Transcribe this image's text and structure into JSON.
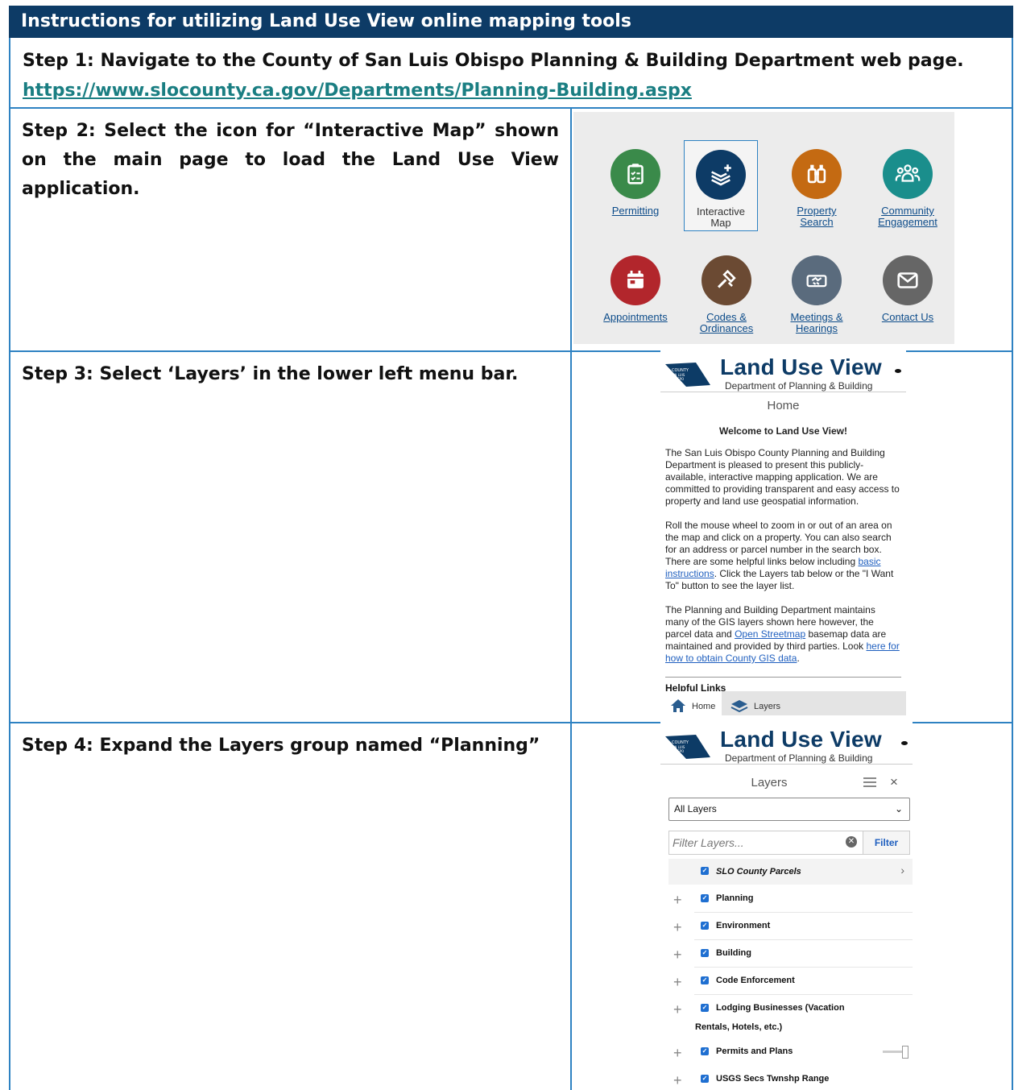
{
  "header": {
    "title": "Instructions for utilizing Land Use View online mapping tools"
  },
  "step1": {
    "text": "Step 1: Navigate to the County of San Luis Obispo Planning & Building Department web page.",
    "link": "https://www.slocounty.ca.gov/Departments/Planning-Building.aspx"
  },
  "step2": {
    "text": "Step 2: Select the icon for “Interactive Map” shown on the main page to load the Land Use View application.",
    "icons": [
      {
        "line1": "Permitting",
        "line2": "",
        "color": "#3a8a4a",
        "icon": "clipboard-icon"
      },
      {
        "line1": "Interactive",
        "line2": "Map",
        "color": "#0d3b66",
        "icon": "layers-plus-icon"
      },
      {
        "line1": "Property",
        "line2": "Search",
        "color": "#c46a12",
        "icon": "binoculars-icon"
      },
      {
        "line1": "Community",
        "line2": "Engagement",
        "color": "#1a8e8c",
        "icon": "people-icon"
      },
      {
        "line1": "Appointments",
        "line2": "",
        "color": "#b2262c",
        "icon": "calendar-icon"
      },
      {
        "line1": "Codes &",
        "line2": "Ordinances",
        "color": "#6b4a33",
        "icon": "gavel-icon"
      },
      {
        "line1": "Meetings &",
        "line2": "Hearings",
        "color": "#5a6b7d",
        "icon": "handshake-icon"
      },
      {
        "line1": "Contact Us",
        "line2": "",
        "color": "#666666",
        "icon": "envelope-icon"
      }
    ]
  },
  "step3": {
    "text": "Step 3: Select ‘Layers’ in the lower left menu bar.",
    "app": {
      "logo_text": "COUNTY SAN LUIS OBISPO",
      "title": "Land Use View",
      "subtitle": "Department of Planning & Building",
      "panel_title": "Home",
      "welcome": "Welcome to Land Use View!",
      "para1": "The San Luis Obispo County Planning and Building Department is pleased to present this publicly-available, interactive mapping application. We are committed to providing transparent and easy access to property and land use geospatial information.",
      "para2_a": "Roll the mouse wheel to zoom in or out of an area on the map and click on a property.  You can also search for an address or parcel number in the search box. There are some helpful links below including ",
      "para2_link": "basic instructions",
      "para2_b": ".  Click the Layers tab below or the \"I Want To\" button to see the layer list.",
      "para3_a": "The Planning and Building Department maintains many of the GIS layers shown here however, the parcel data and ",
      "para3_link1": "Open Streetmap",
      "para3_b": " basemap data are maintained and provided by third parties.  Look ",
      "para3_link2": "here for how to obtain County GIS data",
      "para3_c": ".",
      "helpful_links": "Helpful Links",
      "tab_home": "Home",
      "tab_layers": "Layers"
    }
  },
  "step4": {
    "text": "Step 4: Expand the Layers group named “Planning”",
    "app": {
      "logo_text": "COUNTY SAN LUIS OBISPO",
      "title": "Land Use View",
      "subtitle": "Department of Planning & Building",
      "panel_title": "Layers",
      "close": "×",
      "dropdown_value": "All Layers",
      "filter_placeholder": "Filter Layers...",
      "filter_button": "Filter",
      "layers": [
        {
          "label": "SLO County Parcels",
          "checked": true,
          "expandable": false
        },
        {
          "label": "Planning",
          "checked": true,
          "expandable": true
        },
        {
          "label": "Environment",
          "checked": true,
          "expandable": true
        },
        {
          "label": "Building",
          "checked": true,
          "expandable": true
        },
        {
          "label": "Code Enforcement",
          "checked": true,
          "expandable": true
        },
        {
          "label": "Lodging Businesses (Vacation Rentals, Hotels, etc.)",
          "checked": true,
          "expandable": true
        },
        {
          "label": "Permits and Plans",
          "checked": true,
          "expandable": true
        },
        {
          "label": "USGS Secs Twnshp Range",
          "checked": true,
          "expandable": true
        }
      ]
    }
  }
}
